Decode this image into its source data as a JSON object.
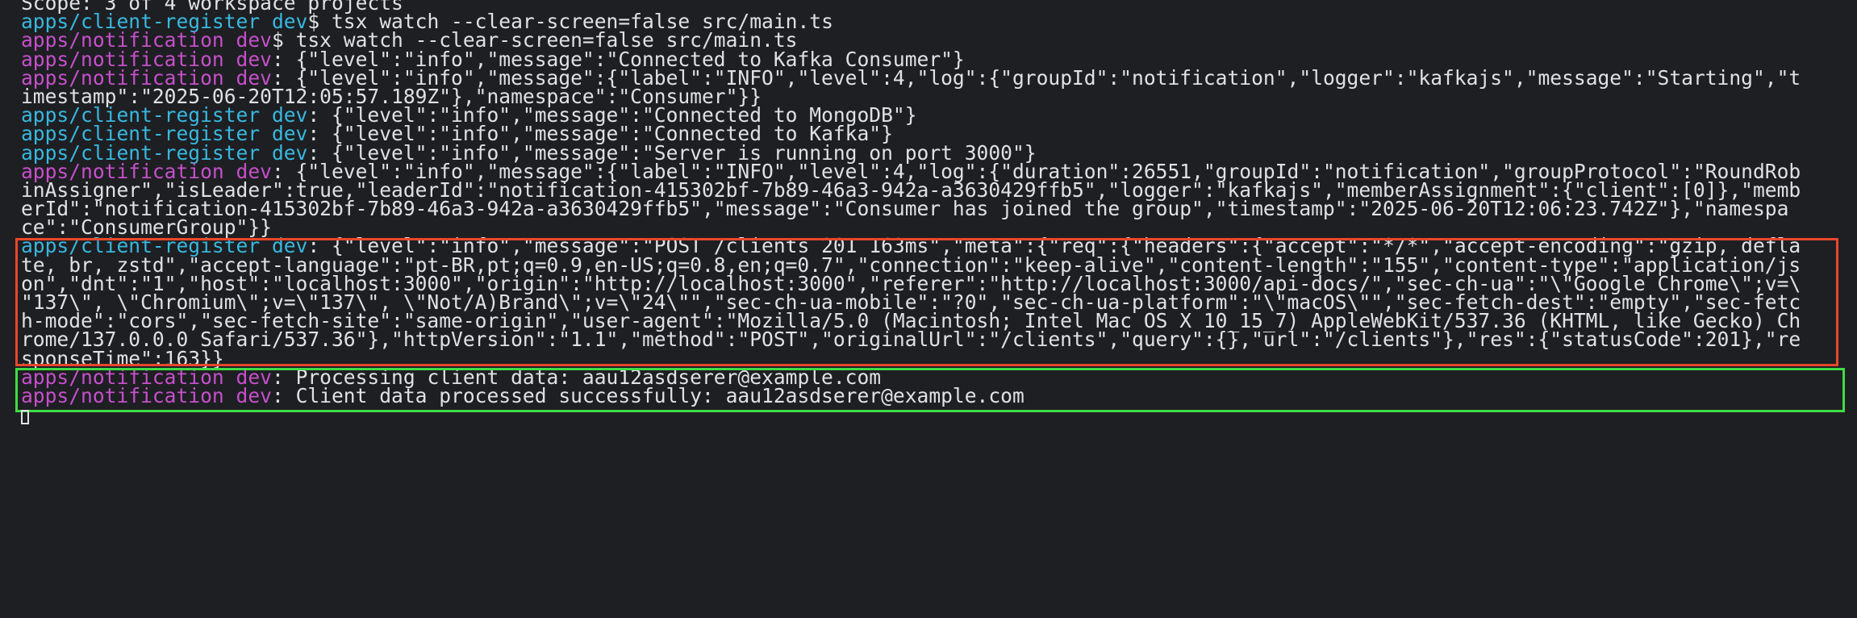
{
  "terminal": {
    "lines": [
      {
        "prefix": "",
        "prefix_type": "none",
        "text": "Scope: 3 of 4 workspace projects"
      },
      {
        "prefix": "apps/client-register dev",
        "prefix_type": "cr",
        "text": "$ tsx watch --clear-screen=false src/main.ts"
      },
      {
        "prefix": "apps/notification dev",
        "prefix_type": "nt",
        "text": "$ tsx watch --clear-screen=false src/main.ts"
      },
      {
        "prefix": "apps/notification dev",
        "prefix_type": "nt",
        "text": ": {\"level\":\"info\",\"message\":\"Connected to Kafka Consumer\"}"
      },
      {
        "prefix": "apps/notification dev",
        "prefix_type": "nt",
        "text": ": {\"level\":\"info\",\"message\":{\"label\":\"INFO\",\"level\":4,\"log\":{\"groupId\":\"notification\",\"logger\":\"kafkajs\",\"message\":\"Starting\",\"t"
      },
      {
        "prefix": "",
        "prefix_type": "none",
        "text": "imestamp\":\"2025-06-20T12:05:57.189Z\"},\"namespace\":\"Consumer\"}}"
      },
      {
        "prefix": "apps/client-register dev",
        "prefix_type": "cr",
        "text": ": {\"level\":\"info\",\"message\":\"Connected to MongoDB\"}"
      },
      {
        "prefix": "apps/client-register dev",
        "prefix_type": "cr",
        "text": ": {\"level\":\"info\",\"message\":\"Connected to Kafka\"}"
      },
      {
        "prefix": "apps/client-register dev",
        "prefix_type": "cr",
        "text": ": {\"level\":\"info\",\"message\":\"Server is running on port 3000\"}"
      },
      {
        "prefix": "apps/notification dev",
        "prefix_type": "nt",
        "text": ": {\"level\":\"info\",\"message\":{\"label\":\"INFO\",\"level\":4,\"log\":{\"duration\":26551,\"groupId\":\"notification\",\"groupProtocol\":\"RoundRob"
      },
      {
        "prefix": "",
        "prefix_type": "none",
        "text": "inAssigner\",\"isLeader\":true,\"leaderId\":\"notification-415302bf-7b89-46a3-942a-a3630429ffb5\",\"logger\":\"kafkajs\",\"memberAssignment\":{\"client\":[0]},\"memb"
      },
      {
        "prefix": "",
        "prefix_type": "none",
        "text": "erId\":\"notification-415302bf-7b89-46a3-942a-a3630429ffb5\",\"message\":\"Consumer has joined the group\",\"timestamp\":\"2025-06-20T12:06:23.742Z\"},\"namespa"
      },
      {
        "prefix": "",
        "prefix_type": "none",
        "text": "ce\":\"ConsumerGroup\"}}"
      },
      {
        "prefix": "apps/client-register dev",
        "prefix_type": "cr",
        "text": ": {\"level\":\"info\",\"message\":\"POST /clients 201 163ms\",\"meta\":{\"req\":{\"headers\":{\"accept\":\"*/*\",\"accept-encoding\":\"gzip, defla"
      },
      {
        "prefix": "",
        "prefix_type": "none",
        "text": "te, br, zstd\",\"accept-language\":\"pt-BR,pt;q=0.9,en-US;q=0.8,en;q=0.7\",\"connection\":\"keep-alive\",\"content-length\":\"155\",\"content-type\":\"application/js"
      },
      {
        "prefix": "",
        "prefix_type": "none",
        "text": "on\",\"dnt\":\"1\",\"host\":\"localhost:3000\",\"origin\":\"http://localhost:3000\",\"referer\":\"http://localhost:3000/api-docs/\",\"sec-ch-ua\":\"\\\"Google Chrome\\\";v=\\"
      },
      {
        "prefix": "",
        "prefix_type": "none",
        "text": "\"137\\\", \\\"Chromium\\\";v=\\\"137\\\", \\\"Not/A)Brand\\\";v=\\\"24\\\"\",\"sec-ch-ua-mobile\":\"?0\",\"sec-ch-ua-platform\":\"\\\"macOS\\\"\",\"sec-fetch-dest\":\"empty\",\"sec-fetc"
      },
      {
        "prefix": "",
        "prefix_type": "none",
        "text": "h-mode\":\"cors\",\"sec-fetch-site\":\"same-origin\",\"user-agent\":\"Mozilla/5.0 (Macintosh; Intel Mac OS X 10_15_7) AppleWebKit/537.36 (KHTML, like Gecko) Ch"
      },
      {
        "prefix": "",
        "prefix_type": "none",
        "text": "rome/137.0.0.0 Safari/537.36\"},\"httpVersion\":\"1.1\",\"method\":\"POST\",\"originalUrl\":\"/clients\",\"query\":{},\"url\":\"/clients\"},\"res\":{\"statusCode\":201},\"re"
      },
      {
        "prefix": "",
        "prefix_type": "none",
        "text": "sponseTime\":163}}"
      },
      {
        "prefix": "apps/notification dev",
        "prefix_type": "nt",
        "text": ": Processing client data: aau12asdserer@example.com"
      },
      {
        "prefix": "apps/notification dev",
        "prefix_type": "nt",
        "text": ": Client data processed successfully: aau12asdserer@example.com"
      }
    ]
  },
  "colors": {
    "background": "#1e1f22",
    "text": "#dfe1e5",
    "client_register_prefix": "#37b8e0",
    "notification_prefix": "#c64fcc",
    "highlight_red": "#e8472b",
    "highlight_green": "#3fdc45"
  }
}
